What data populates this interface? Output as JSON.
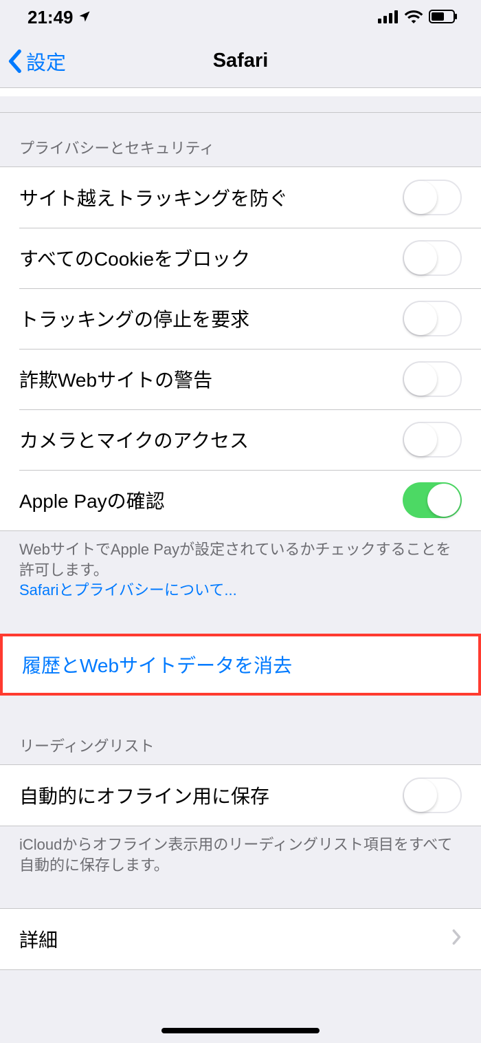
{
  "statusbar": {
    "time": "21:49"
  },
  "nav": {
    "back_label": "設定",
    "title": "Safari"
  },
  "sections": {
    "privacy_header": "プライバシーとセキュリティ",
    "rows": {
      "cross_site": "サイト越えトラッキングを防ぐ",
      "block_cookies": "すべてのCookieをブロック",
      "do_not_track": "トラッキングの停止を要求",
      "fraud_warning": "詐欺Webサイトの警告",
      "camera_mic": "カメラとマイクのアクセス",
      "apple_pay": "Apple Payの確認"
    },
    "privacy_footer_text": "WebサイトでApple Payが設定されているかチェックすることを許可します。",
    "privacy_footer_link": "Safariとプライバシーについて...",
    "clear_data": "履歴とWebサイトデータを消去",
    "reading_header": "リーディングリスト",
    "auto_save": "自動的にオフライン用に保存",
    "reading_footer": "iCloudからオフライン表示用のリーディングリスト項目をすべて自動的に保存します。",
    "advanced": "詳細"
  },
  "toggles": {
    "cross_site": false,
    "block_cookies": false,
    "do_not_track": false,
    "fraud_warning": false,
    "camera_mic": false,
    "apple_pay": true,
    "auto_save": false
  }
}
